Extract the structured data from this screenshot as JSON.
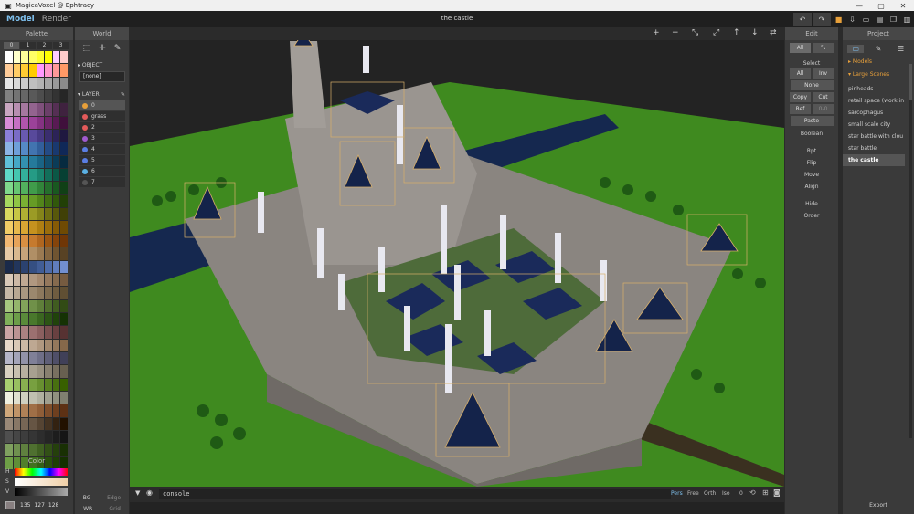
{
  "window": {
    "title": "MagicaVoxel @ Ephtracy",
    "controls": [
      "minimize-icon",
      "maximize-icon",
      "close-icon"
    ]
  },
  "menubar": {
    "modes": [
      "Model",
      "Render"
    ],
    "document_title": "the castle",
    "accent": "#7ec0ee"
  },
  "palette": {
    "header": "Palette",
    "tabs": [
      "0",
      "1",
      "2",
      "3"
    ],
    "color_header": "Color",
    "hsv_labels": [
      "H",
      "S",
      "V"
    ],
    "rgb": [
      "135",
      "127",
      "128"
    ],
    "colors": [
      "#ffffff",
      "#ffffcc",
      "#ffff99",
      "#ffff66",
      "#ffff33",
      "#ffff00",
      "#ffccff",
      "#ffcccc",
      "#ffcc99",
      "#ffcc66",
      "#ffcc33",
      "#ffcc00",
      "#ff99ff",
      "#ff99cc",
      "#ff9999",
      "#ff9966",
      "#e6e6e6",
      "#d8d8d8",
      "#cccccc",
      "#bfbfbf",
      "#b3b3b3",
      "#a6a6a6",
      "#999999",
      "#8c8c8c",
      "#808080",
      "#737373",
      "#666666",
      "#595959",
      "#4d4d4d",
      "#404040",
      "#333333",
      "#262626",
      "#c9a6c0",
      "#b88eb0",
      "#a5789f",
      "#93648f",
      "#7f507c",
      "#6b3f69",
      "#552f54",
      "#3f223f",
      "#d98cd6",
      "#c66fc3",
      "#b055ad",
      "#9b4299",
      "#853282",
      "#6f2569",
      "#581a53",
      "#40103c",
      "#8c7fd9",
      "#7a6cc6",
      "#6859b0",
      "#58499b",
      "#483a85",
      "#3a2e6f",
      "#2c2358",
      "#1f1840",
      "#8cb4e6",
      "#6f9fd9",
      "#5589c6",
      "#4274b0",
      "#325f9b",
      "#244b85",
      "#19396f",
      "#102858",
      "#5fc0d9",
      "#45a8c6",
      "#3391b0",
      "#257a9b",
      "#1a6485",
      "#124f6f",
      "#0b3c58",
      "#062b40",
      "#5fd9c6",
      "#45c6b0",
      "#33b09b",
      "#259b85",
      "#1a856f",
      "#126f5a",
      "#0b5846",
      "#064033",
      "#7fd98c",
      "#66c673",
      "#52b05e",
      "#409b4b",
      "#31853a",
      "#246f2c",
      "#195820",
      "#104016",
      "#a6d95f",
      "#8fc645",
      "#7ab033",
      "#669b25",
      "#52851a",
      "#416f12",
      "#31580b",
      "#224006",
      "#d9d95f",
      "#c6c645",
      "#b0b033",
      "#9b9b25",
      "#85851a",
      "#6f6f12",
      "#58580b",
      "#404006",
      "#f2cc66",
      "#e6b84d",
      "#d9a633",
      "#c6921f",
      "#b07f12",
      "#9b6d0b",
      "#855a06",
      "#6f4a03",
      "#f2b873",
      "#e6a35a",
      "#d98f42",
      "#c67a2e",
      "#b0661f",
      "#9b5512",
      "#85440b",
      "#6f3606",
      "#e6c9a6",
      "#d9b88f",
      "#c6a37a",
      "#b08f66",
      "#9b7a52",
      "#856640",
      "#6f5431",
      "#584224",
      "#1a2a4a",
      "#22365c",
      "#2b426f",
      "#354f82",
      "#415d96",
      "#4f6ca9",
      "#607dbd",
      "#728fd0",
      "#d9c9b8",
      "#ccb9a6",
      "#bfa993",
      "#b09880",
      "#a3886e",
      "#94785d",
      "#856a4e",
      "#765b40",
      "#c6b8a6",
      "#b8a893",
      "#a99880",
      "#9b886e",
      "#8c785d",
      "#7d6a4e",
      "#6f5c40",
      "#604f33",
      "#a6c67f",
      "#94b56c",
      "#82a35a",
      "#709149",
      "#5f7f3a",
      "#4f6e2c",
      "#405c20",
      "#324b15",
      "#7fb05a",
      "#6c9d49",
      "#5a8a3a",
      "#49782c",
      "#3a6620",
      "#2c5415",
      "#20430b",
      "#153204",
      "#caa5a5",
      "#bb9393",
      "#ab8181",
      "#9b7070",
      "#8a5f5f",
      "#794f4f",
      "#684040",
      "#573232",
      "#e8d8c8",
      "#dac8b6",
      "#ccb8a4",
      "#bea892",
      "#b09880",
      "#a2886e",
      "#94785c",
      "#86684a",
      "#b5b5c8",
      "#a3a3b8",
      "#9292a8",
      "#808098",
      "#6f6f88",
      "#5f5f78",
      "#4f4f68",
      "#404058",
      "#d8d0c0",
      "#c8c0b0",
      "#b8b0a0",
      "#a8a090",
      "#989080",
      "#888070",
      "#787060",
      "#686050",
      "#a8d070",
      "#98c060",
      "#88b050",
      "#78a040",
      "#689030",
      "#588020",
      "#487010",
      "#386000",
      "#f0f0e0",
      "#e0e0d0",
      "#d0d0c0",
      "#c0c0b0",
      "#b0b0a0",
      "#a0a090",
      "#909080",
      "#808070",
      "#cfa77a",
      "#c09468",
      "#b08157",
      "#a06f47",
      "#905e38",
      "#7f4e2b",
      "#6e3f1f",
      "#5d3114",
      "#998877",
      "#887766",
      "#776655",
      "#665544",
      "#554433",
      "#443322",
      "#332211",
      "#221100",
      "#4f4f4f",
      "#464646",
      "#3d3d3d",
      "#353535",
      "#2d2d2d",
      "#252525",
      "#1d1d1d",
      "#151515",
      "#7fa05f",
      "#6f904f",
      "#5f803f",
      "#4f7030",
      "#406022",
      "#325016",
      "#25400c",
      "#193004",
      "#6e9f46",
      "#5f8f38",
      "#50802b",
      "#42701f",
      "#356015",
      "#29500c",
      "#1e4005",
      "#153000"
    ]
  },
  "world": {
    "header": "World",
    "tools": [
      "select-box-icon",
      "move-icon",
      "eyedropper-icon"
    ],
    "object_label": "OBJECT",
    "object_value": "[none]",
    "layer_label": "LAYER",
    "layers": [
      {
        "name": "0",
        "color": "#e8a03a"
      },
      {
        "name": "grass",
        "color": "#e35a5a"
      },
      {
        "name": "2",
        "color": "#e35a5a"
      },
      {
        "name": "3",
        "color": "#a05ad0"
      },
      {
        "name": "4",
        "color": "#5a7ee3"
      },
      {
        "name": "5",
        "color": "#5a7ee3"
      },
      {
        "name": "6",
        "color": "#5ab0e3"
      },
      {
        "name": "7",
        "color": "#555555"
      }
    ],
    "footer": [
      [
        "BG",
        "Edge"
      ],
      [
        "WR",
        "Grid"
      ]
    ]
  },
  "viewport": {
    "toolbar": [
      "plus-icon",
      "minus-icon",
      "shrink-icon",
      "expand-icon",
      "arrow-up-icon",
      "arrow-down-icon",
      "swap-icon"
    ],
    "console_placeholder": "console",
    "cameras": [
      "Pers",
      "Free",
      "Orth",
      "Iso"
    ],
    "camera_value": "0"
  },
  "edit": {
    "header": "Edit",
    "modes": [
      "All",
      "shrink"
    ],
    "select_label": "Select",
    "select_buttons": [
      [
        "All",
        "Inv"
      ],
      [
        "None"
      ],
      [
        "Copy",
        "Cut"
      ],
      [
        "Ref",
        "0-0"
      ],
      [
        "Paste"
      ]
    ],
    "boolean": "Boolean",
    "items": [
      "Rpt",
      "Flip",
      "Move",
      "Align",
      "Hide",
      "Order"
    ]
  },
  "project": {
    "header": "Project",
    "tabs": [
      "folder-icon",
      "brush-icon",
      "list-icon"
    ],
    "folders": [
      "Models",
      "Large Scenes"
    ],
    "items": [
      "pinheads",
      "retail space (work in",
      "sarcophagus",
      "small scale city",
      "star battle with clou",
      "star battle",
      "the castle"
    ],
    "selected": "the castle",
    "export": "Export"
  }
}
